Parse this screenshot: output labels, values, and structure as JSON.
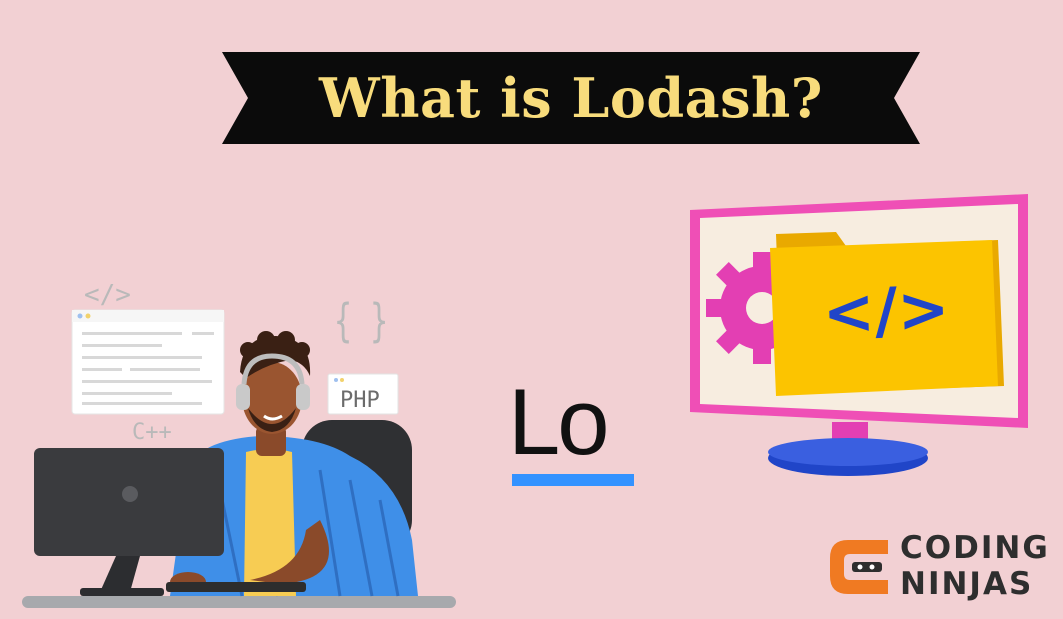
{
  "banner": {
    "title": "What is Lodash?"
  },
  "lodash_logo": {
    "text": "Lo"
  },
  "code_tags": {
    "html_tag": "</>",
    "braces": "{ }",
    "php_label": "PHP",
    "cpp_label": "C++",
    "monitor_code_tag": "</>"
  },
  "brand": {
    "line1": "CODING",
    "line2": "NINJAS"
  },
  "colors": {
    "background": "#f2d0d3",
    "banner": "#0b0b0b",
    "banner_text": "#f8dc7c",
    "lodash_blue": "#3492ff",
    "monitor_frame": "#ef4fb6",
    "folder": "#fcc400",
    "code_blue": "#2045c8",
    "gear": "#e33fb3",
    "brand_orange": "#f07a22"
  }
}
